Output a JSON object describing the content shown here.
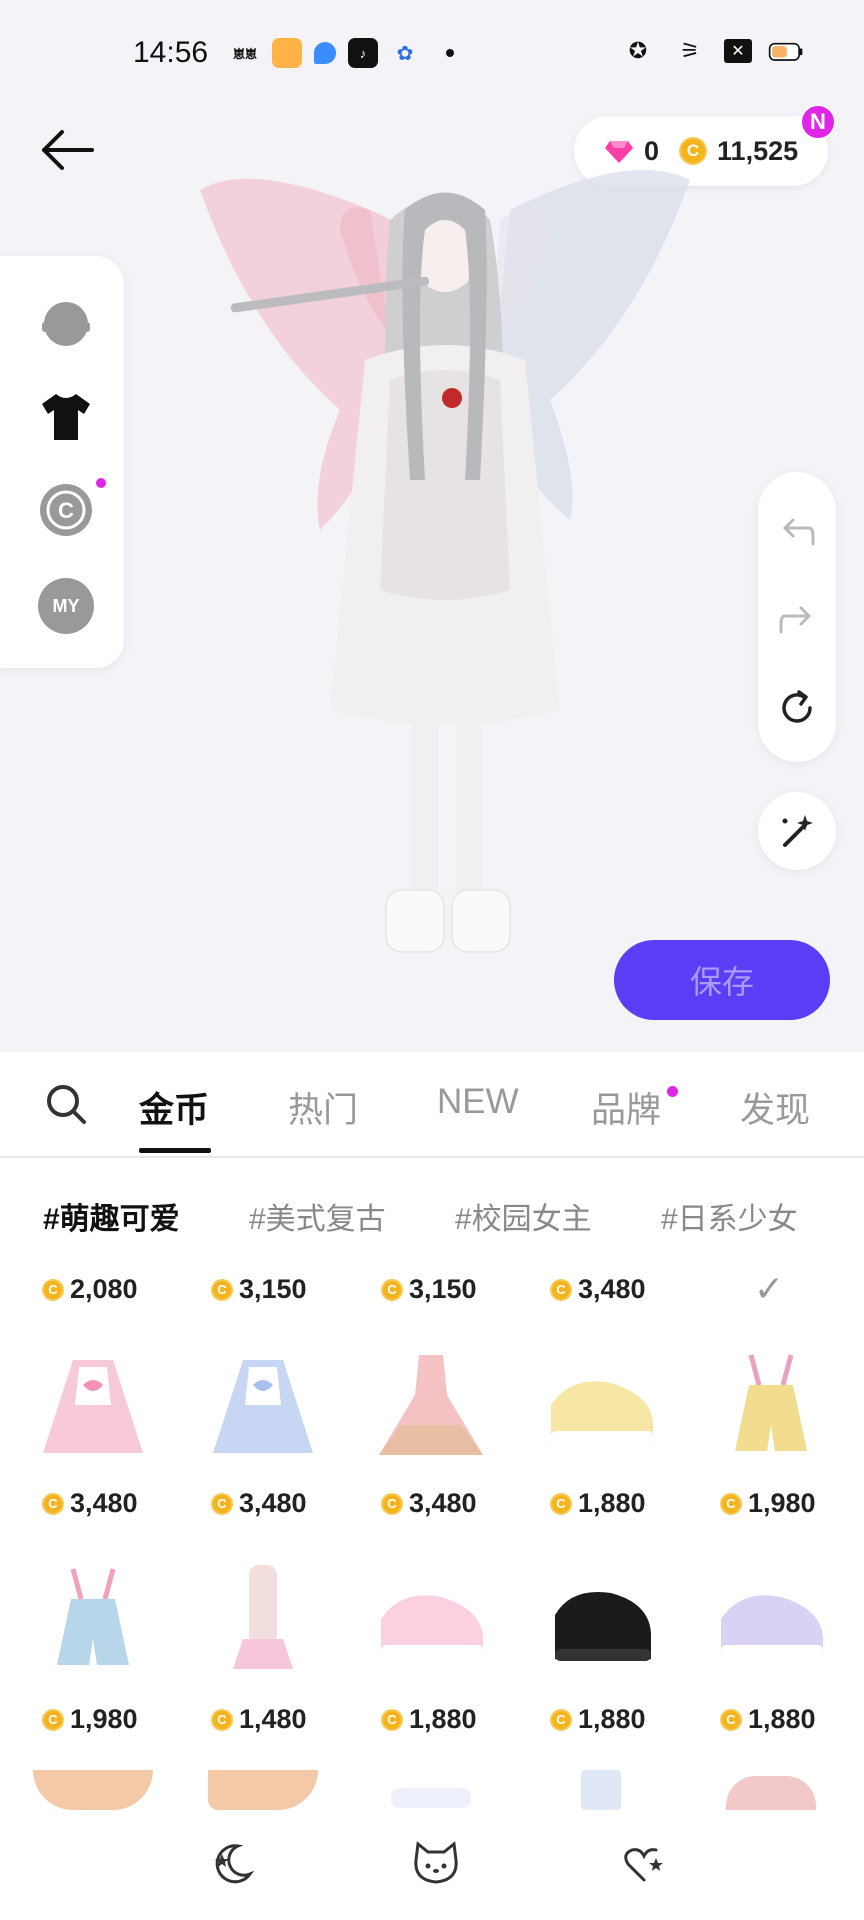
{
  "status_bar": {
    "time": "14:56",
    "apps": [
      {
        "name": "app-icon-1",
        "label": "崽崽",
        "color": "#ffffff",
        "text": "#111"
      },
      {
        "name": "app-icon-2",
        "label": "",
        "color": "#ff9c33",
        "text": "#fff"
      },
      {
        "name": "app-icon-3",
        "label": "",
        "color": "#3b8cff",
        "text": "#fff"
      },
      {
        "name": "tiktok-icon",
        "label": "♪",
        "color": "#111111",
        "text": "#fff"
      },
      {
        "name": "baidu-icon",
        "label": "🐾",
        "color": "#ffffff",
        "text": "#2b6de6"
      }
    ]
  },
  "header": {
    "back_icon": "arrow-left-icon",
    "diamonds": "0",
    "coins": "11,525",
    "badge": "N"
  },
  "actions": {
    "save_label": "保存"
  },
  "tabs": [
    {
      "label": "金币",
      "active": true
    },
    {
      "label": "热门",
      "active": false
    },
    {
      "label": "NEW",
      "active": false
    },
    {
      "label": "品牌",
      "active": false,
      "dot": true
    },
    {
      "label": "发现",
      "active": false
    }
  ],
  "tags": [
    {
      "label": "#萌趣可爱",
      "active": true
    },
    {
      "label": "#美式复古",
      "active": false
    },
    {
      "label": "#校园女主",
      "active": false
    },
    {
      "label": "#日系少女",
      "active": false
    }
  ],
  "coin_symbol": "C",
  "row1_prices": [
    "2,080",
    "3,150",
    "3,150",
    "3,480"
  ],
  "row2": [
    {
      "name": "pink-maid-dress",
      "price": "3,480"
    },
    {
      "name": "blue-maid-dress",
      "price": "3,480"
    },
    {
      "name": "pink-ruffle-dress",
      "price": "3,480"
    },
    {
      "name": "yellow-sneakers",
      "price": "1,880"
    },
    {
      "name": "yellow-overalls",
      "price": "1,980"
    }
  ],
  "row3": [
    {
      "name": "blue-overalls",
      "price": "1,980"
    },
    {
      "name": "leg-warmers",
      "price": "1,480"
    },
    {
      "name": "pink-sneakers",
      "price": "1,880"
    },
    {
      "name": "black-platform-shoes",
      "price": "1,880"
    },
    {
      "name": "lavender-sneakers",
      "price": "1,880"
    }
  ],
  "lp_label_my": "MY",
  "lp_label_c": "C"
}
